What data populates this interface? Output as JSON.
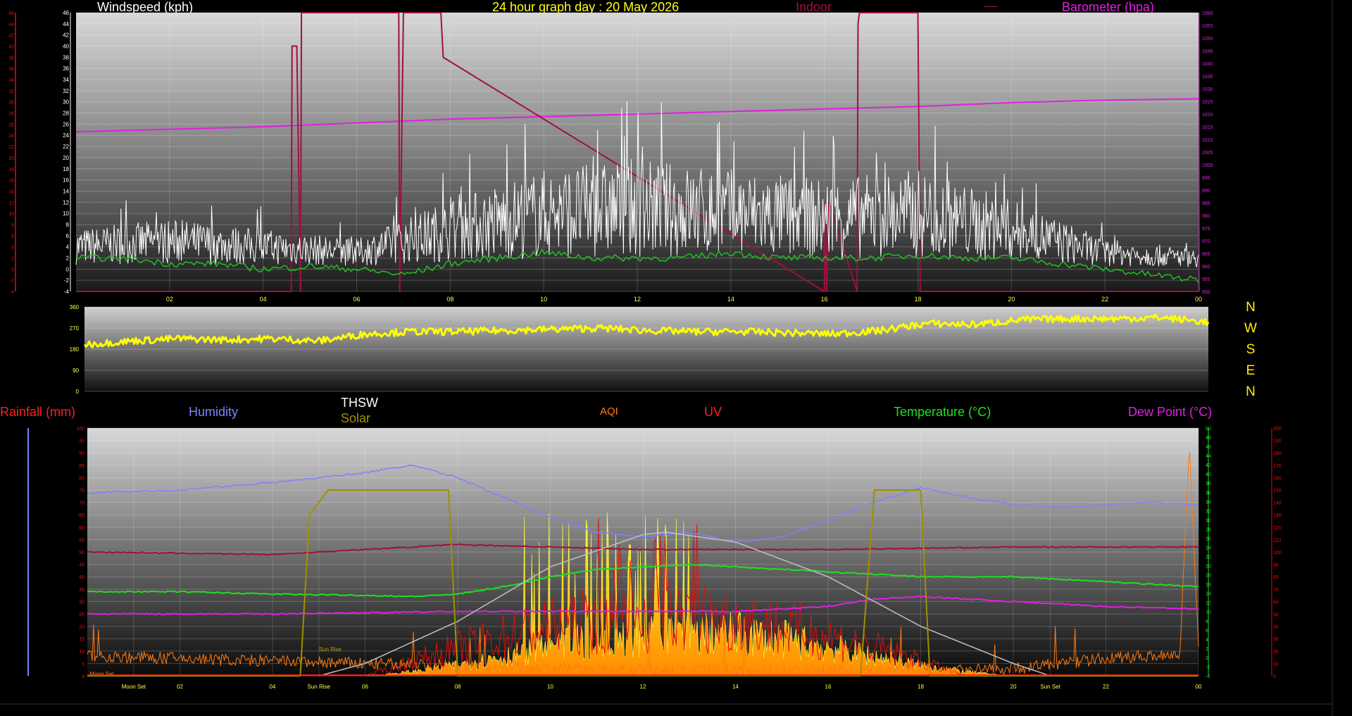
{
  "header": {
    "windspeed_label": "Windspeed (kph)",
    "graph_title": "24 hour graph day : 20 May 2026",
    "indoor_label": "Indoor",
    "dash_label": "—",
    "barometer_label": "Barometer (hpa)"
  },
  "lower_header": {
    "rainfall_label": "Rainfall (mm)",
    "humidity_label": "Humidity",
    "thsw_label": "THSW",
    "solar_label": "Solar",
    "aqi_label": "AQI",
    "uv_label": "UV",
    "temperature_label": "Temperature (°C)",
    "dewpoint_label": "Dew Point (°C)"
  },
  "compass": [
    "N",
    "W",
    "S",
    "E",
    "N"
  ],
  "colors": {
    "wind": "#ffffff",
    "gust": "#ffffff",
    "barometer": "#e020e0",
    "indoor": "#a01040",
    "green": "#20c020",
    "direction": "#ffff00",
    "humidity": "#8080ff",
    "temperature": "#20e020",
    "dewpoint": "#e020e0",
    "solar": "#ffd000",
    "solar_line": "#a09000",
    "uv": "#e01010",
    "aqi": "#ff7a10",
    "rain": "#ff2020",
    "thsw": "#c0c0c0",
    "tick_yellow": "#ffff40"
  },
  "chart_data": [
    {
      "type": "line",
      "x_ticks": [
        "02",
        "04",
        "06",
        "08",
        "10",
        "12",
        "14",
        "16",
        "18",
        "20",
        "22",
        "00"
      ],
      "y_left_ticks": [
        "-4",
        "-2",
        "0",
        "2",
        "4",
        "6",
        "8",
        "10",
        "12",
        "14",
        "16",
        "18",
        "20",
        "22",
        "24",
        "26",
        "28",
        "30",
        "32",
        "34",
        "36",
        "38",
        "40",
        "42",
        "44",
        "46"
      ],
      "y_right_ticks": [
        "950",
        "955",
        "960",
        "965",
        "970",
        "975",
        "980",
        "985",
        "990",
        "995",
        "1000",
        "1005",
        "1010",
        "1015",
        "1020",
        "1025",
        "1030",
        "1035",
        "1040",
        "1045",
        "1050",
        "1055",
        "1060"
      ],
      "ylim_left": [
        -4,
        46
      ],
      "ylim_right": [
        950,
        1060
      ],
      "series": [
        {
          "name": "Barometer (hpa)",
          "x": [
            0,
            2,
            4,
            6,
            8,
            10,
            12,
            14,
            16,
            18,
            20,
            22,
            24
          ],
          "values": [
            1013,
            1014,
            1015,
            1016.5,
            1018,
            1019,
            1020,
            1021,
            1022,
            1023,
            1024.5,
            1025.5,
            1026
          ]
        },
        {
          "name": "Indoor",
          "x": [
            0,
            4.6,
            4.62,
            4.72,
            4.8,
            4.82,
            5.2,
            5.22,
            6.9,
            6.92,
            7.0,
            7.05,
            7.8,
            7.85,
            16.0,
            16.02,
            16.05,
            16.1,
            16.7,
            16.72,
            16.75,
            18.0,
            18.05,
            24
          ],
          "values": [
            -4,
            -4,
            40,
            40,
            -4,
            46,
            46,
            46,
            46,
            -4,
            46,
            46,
            46,
            38,
            -4,
            12,
            -4,
            12,
            -4,
            44,
            46,
            46,
            -4,
            -4
          ]
        },
        {
          "name": "Windspeed (kph)",
          "x": [
            0,
            2,
            4,
            6,
            8,
            10,
            12,
            14,
            16,
            18,
            20,
            22,
            24
          ],
          "values": [
            4,
            5,
            4,
            3,
            7,
            10,
            11,
            10,
            9,
            10,
            7,
            3,
            2
          ]
        },
        {
          "name": "Wind green",
          "x": [
            0,
            1,
            2,
            3,
            4,
            5,
            6,
            7,
            8,
            9,
            10,
            11,
            12,
            13,
            14,
            15,
            16,
            17,
            18,
            19,
            20,
            21,
            22,
            23,
            24
          ],
          "values": [
            2,
            2,
            1,
            1,
            0,
            0.5,
            0,
            -1,
            1,
            2,
            3,
            2,
            2,
            2,
            3,
            2,
            2,
            2,
            2.5,
            2,
            2,
            1,
            0,
            -1,
            -2
          ]
        }
      ]
    },
    {
      "type": "scatter",
      "x_ticks": [],
      "y_ticks": [
        "0",
        "90",
        "180",
        "270",
        "360"
      ],
      "ylim": [
        0,
        360
      ],
      "series": [
        {
          "name": "Wind direction",
          "x": [
            0,
            1,
            2,
            3,
            4,
            5,
            6,
            7,
            8,
            9,
            10,
            11,
            12,
            13,
            14,
            15,
            16,
            17,
            18,
            19,
            20,
            21,
            22,
            23,
            24
          ],
          "values": [
            200,
            215,
            225,
            220,
            225,
            215,
            245,
            255,
            255,
            260,
            265,
            270,
            260,
            255,
            255,
            250,
            245,
            260,
            290,
            285,
            305,
            310,
            310,
            315,
            295
          ]
        }
      ]
    },
    {
      "type": "line",
      "x_ticks": [
        "Moon Set",
        "02",
        "04",
        "Sun Rise",
        "06",
        "08",
        "10",
        "12",
        "14",
        "16",
        "18",
        "20",
        "Sun Set",
        "22",
        "00"
      ],
      "y_left_ticks": [
        "0",
        "5",
        "10",
        "15",
        "20",
        "25",
        "30",
        "35",
        "40",
        "45",
        "50",
        "55",
        "60",
        "65",
        "70",
        "75",
        "80",
        "85",
        "90",
        "95",
        "100"
      ],
      "y_temp_ticks": [
        "-4",
        "-2",
        "0",
        "2",
        "4",
        "6",
        "8",
        "10",
        "12",
        "14",
        "16",
        "18",
        "20",
        "22",
        "24",
        "26",
        "28",
        "30",
        "32",
        "34",
        "36",
        "38",
        "40",
        "42",
        "44",
        "46",
        "48",
        "50"
      ],
      "y_aqi_ticks": [
        "0",
        "10",
        "20",
        "30",
        "40",
        "50",
        "60",
        "70",
        "80",
        "90",
        "100",
        "110",
        "120",
        "130",
        "140",
        "150",
        "160",
        "170",
        "180",
        "190",
        "200"
      ],
      "annotations": [
        "Sun Rise",
        "Moon Set"
      ],
      "series": [
        {
          "name": "Humidity",
          "x": [
            0,
            2,
            4,
            6,
            7,
            8,
            9,
            10,
            11,
            12,
            13,
            14,
            15,
            16,
            17,
            18,
            19,
            20,
            21,
            22,
            23,
            24
          ],
          "values": [
            74,
            75,
            78,
            82,
            85,
            80,
            72,
            64,
            58,
            56,
            58,
            54,
            56,
            63,
            70,
            76,
            72,
            69,
            68,
            69,
            70,
            69
          ]
        },
        {
          "name": "Temperature (°C)",
          "x": [
            0,
            2,
            4,
            6,
            7,
            8,
            9,
            10,
            11,
            12,
            13,
            14,
            15,
            16,
            17,
            18,
            19,
            20,
            21,
            22,
            23,
            24
          ],
          "values": [
            34,
            34,
            33,
            32.5,
            32,
            33,
            36,
            40,
            43,
            44,
            45,
            44,
            43,
            42,
            41,
            40,
            40,
            40,
            39,
            38,
            37,
            36
          ]
        },
        {
          "name": "Dew Point (°C)",
          "x": [
            0,
            4,
            8,
            12,
            14,
            16,
            17,
            18,
            20,
            22,
            24
          ],
          "values": [
            25,
            25,
            26,
            26,
            26,
            28,
            31,
            32,
            30,
            28,
            27
          ]
        },
        {
          "name": "Indoor",
          "x": [
            0,
            4,
            8,
            12,
            16,
            20,
            24
          ],
          "values": [
            50,
            49,
            53,
            51,
            51,
            52,
            52
          ]
        },
        {
          "name": "THSW",
          "x": [
            5,
            6,
            8,
            10,
            12,
            12.5,
            14,
            16,
            18,
            20,
            20.8
          ],
          "values": [
            0,
            5,
            22,
            44,
            57,
            58,
            54,
            40,
            20,
            5,
            0
          ]
        },
        {
          "name": "Solar",
          "x": [
            0,
            4.6,
            4.8,
            5.2,
            7.8,
            8.0,
            16.7,
            17.0,
            18.0,
            18.2,
            24
          ],
          "values": [
            0,
            0,
            65,
            75,
            75,
            0,
            0,
            75,
            75,
            0,
            0
          ]
        },
        {
          "name": "AQI",
          "x": [
            0,
            2,
            4,
            6,
            8,
            10,
            12,
            14,
            16,
            18,
            20,
            22,
            23.6,
            23.8,
            24
          ],
          "values": [
            8,
            7,
            6,
            5,
            4,
            3,
            2,
            2,
            2,
            2,
            3,
            7,
            9,
            95,
            12
          ]
        }
      ]
    }
  ]
}
